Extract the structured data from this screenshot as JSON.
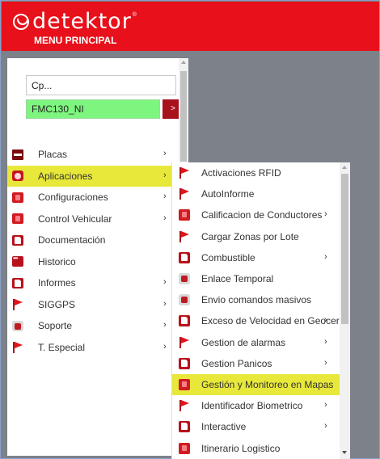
{
  "header": {
    "brand": "detektor",
    "brand_mark": "®",
    "menu_title": "MENU PRINCIPAL"
  },
  "search": {
    "value": "Cp..."
  },
  "unit": {
    "value": "FMC130_NI",
    "go_label": ">"
  },
  "left_menu": {
    "items": [
      {
        "label": "Placas",
        "icon": "card-icon",
        "has_arrow": true,
        "arrow": "›"
      },
      {
        "label": "Aplicaciones",
        "icon": "apps-icon",
        "has_arrow": true,
        "arrow": "›",
        "active": true
      },
      {
        "label": "Configuraciones",
        "icon": "settings-icon",
        "has_arrow": true,
        "arrow": "›"
      },
      {
        "label": "Control Vehicular",
        "icon": "vehicle-icon",
        "has_arrow": true,
        "arrow": "›"
      },
      {
        "label": "Documentación",
        "icon": "document-icon",
        "has_arrow": false
      },
      {
        "label": "Historico",
        "icon": "history-icon",
        "has_arrow": false
      },
      {
        "label": "Informes",
        "icon": "report-icon",
        "has_arrow": true,
        "arrow": "›"
      },
      {
        "label": "SIGGPS",
        "icon": "flag-icon",
        "has_arrow": true,
        "arrow": "›"
      },
      {
        "label": "Soporte",
        "icon": "support-icon",
        "has_arrow": true,
        "arrow": "›"
      },
      {
        "label": "T. Especial",
        "icon": "flag-icon",
        "has_arrow": true,
        "arrow": "›"
      }
    ]
  },
  "submenu": {
    "items": [
      {
        "label": "Activaciones RFID",
        "icon": "flag-icon",
        "has_arrow": false
      },
      {
        "label": "AutoInforme",
        "icon": "flag-icon",
        "has_arrow": false
      },
      {
        "label": "Calificacion de Conductores",
        "icon": "box-icon",
        "has_arrow": true,
        "arrow": "›"
      },
      {
        "label": "Cargar Zonas por Lote",
        "icon": "flag-icon",
        "has_arrow": false
      },
      {
        "label": "Combustible",
        "icon": "fuel-icon",
        "has_arrow": true,
        "arrow": "›"
      },
      {
        "label": "Enlace Temporal",
        "icon": "link-icon",
        "has_arrow": false
      },
      {
        "label": "Envio comandos masivos",
        "icon": "command-icon",
        "has_arrow": false
      },
      {
        "label": "Exceso de Velocidad en Geocerca",
        "icon": "speed-icon",
        "has_arrow": true,
        "arrow": "›"
      },
      {
        "label": "Gestion de alarmas",
        "icon": "flag-icon",
        "has_arrow": true,
        "arrow": "›"
      },
      {
        "label": "Gestion Panicos",
        "icon": "panic-icon",
        "has_arrow": true,
        "arrow": "›"
      },
      {
        "label": "Gestión y Monitoreo en Mapas",
        "icon": "map-icon",
        "has_arrow": false,
        "active": true
      },
      {
        "label": "Identificador Biometrico",
        "icon": "flag-icon",
        "has_arrow": true,
        "arrow": "›"
      },
      {
        "label": "Interactive",
        "icon": "document-icon",
        "has_arrow": true,
        "arrow": "›"
      },
      {
        "label": "Itinerario Logistico",
        "icon": "box-icon",
        "has_arrow": false
      }
    ]
  }
}
